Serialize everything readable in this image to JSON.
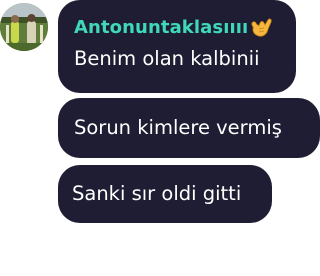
{
  "chat": {
    "sender": {
      "name": "Antonuntaklasıııı",
      "name_color": "#3fd9b9",
      "badge_emoji": "call-me-hand-emoji"
    },
    "bubble_color": "#1e1d33",
    "messages": [
      {
        "text": "Benim olan kalbinii"
      },
      {
        "text": "Sorun kimlere vermiş"
      },
      {
        "text": "Sanki sır oldi gitti"
      }
    ]
  }
}
